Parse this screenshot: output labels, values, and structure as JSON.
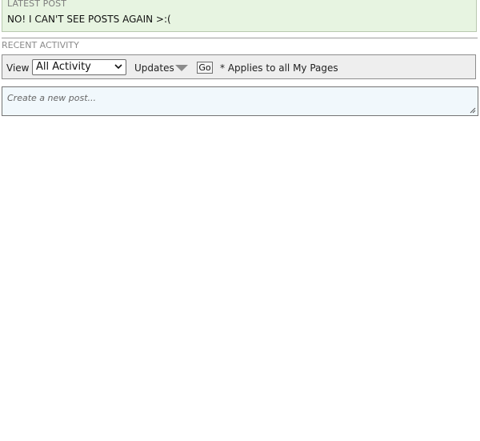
{
  "latest_post": {
    "heading": "LATEST POST",
    "text": "NO! I CAN'T SEE POSTS AGAIN >:("
  },
  "recent_activity": {
    "heading": "RECENT ACTIVITY"
  },
  "toolbar": {
    "view_label": "View",
    "view_select_value": "All Activity",
    "updates_label": "Updates",
    "go_label": "Go",
    "applies_note": "* Applies to all My Pages"
  },
  "new_post": {
    "placeholder": "Create a new post..."
  }
}
